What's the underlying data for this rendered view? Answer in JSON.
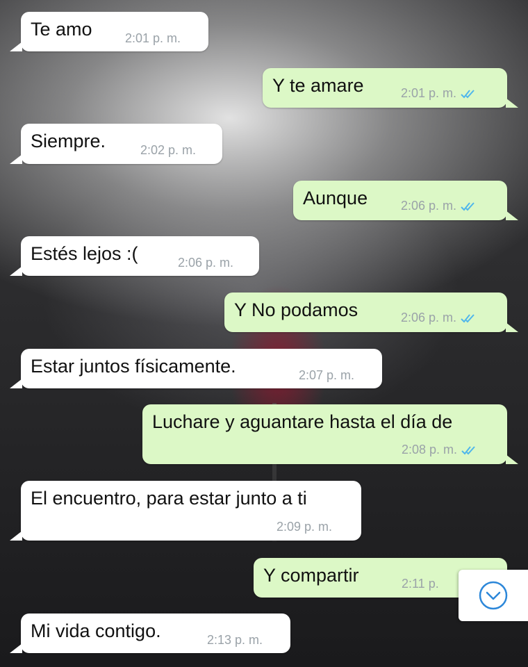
{
  "messages": [
    {
      "text": "Te amo",
      "time": "2:01 p. m.",
      "sent": false
    },
    {
      "text": "Y te amare",
      "time": "2:01 p. m.",
      "sent": true
    },
    {
      "text": "Siempre.",
      "time": "2:02 p. m.",
      "sent": false
    },
    {
      "text": "Aunque",
      "time": "2:06 p. m.",
      "sent": true
    },
    {
      "text": "Estés lejos :(",
      "time": "2:06 p. m.",
      "sent": false
    },
    {
      "text": "Y No podamos",
      "time": "2:06 p. m.",
      "sent": true
    },
    {
      "text": "Estar juntos físicamente.",
      "time": "2:07 p. m.",
      "sent": false
    },
    {
      "text": "Luchare y aguantare hasta el día de",
      "time": "2:08 p. m.",
      "sent": true
    },
    {
      "text": "El encuentro, para estar junto a ti",
      "time": "2:09 p. m.",
      "sent": false
    },
    {
      "text": "Y compartir",
      "time": "2:11 p.",
      "sent": true
    },
    {
      "text": "Mi vida contigo.",
      "time": "2:13 p. m.",
      "sent": false
    }
  ],
  "icons": {
    "read_receipt": "double-check-icon",
    "scroll_down": "chevron-down-circle-icon"
  },
  "colors": {
    "incoming_bubble": "#ffffff",
    "outgoing_bubble": "#dcf8c6",
    "timestamp": "#9aa2a8",
    "read_check": "#4fb6ec",
    "scroll_icon": "#2c87d9"
  }
}
